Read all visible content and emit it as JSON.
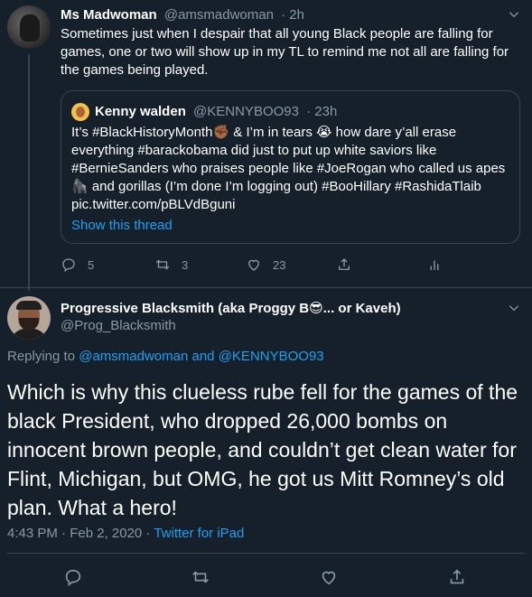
{
  "tweet1": {
    "name": "Ms Madwoman",
    "handle": "@amsmadwoman",
    "time": "· 2h",
    "text": "Sometimes just when I despair that all young Black people are falling for games, one or two will show up in my TL  to remind me not all are falling for the games being played.",
    "quote": {
      "name": "Kenny walden",
      "handle": "@KENNYBOO93",
      "time": "· 23h",
      "text": "It’s #BlackHistoryMonth✊🏾 & I’m in tears 😭 how dare y’all erase everything #barackobama did just to put up white saviors like #BernieSanders who praises people like #JoeRogan who called us apes 🦍 and gorillas (I’m done I’m logging out) #BooHillary #RashidaTlaib pic.twitter.com/pBLVdBguni",
      "show_thread": "Show this thread"
    },
    "actions": {
      "replies": "5",
      "retweets": "3",
      "likes": "23"
    }
  },
  "tweet2": {
    "name": "Progressive Blacksmith (aka Proggy B😎... or Kaveh)",
    "handle": "@Prog_Blacksmith",
    "replying_prefix": "Replying to",
    "reply_user1": "@amsmadwoman",
    "reply_and": "and",
    "reply_user2": "@KENNYBOO93",
    "text": "Which is why this clueless rube fell for the games of the black President, who dropped 26,000 bombs on innocent brown people, and couldn’t get clean water for Flint, Michigan, but OMG, he got us Mitt Romney’s old plan. What a hero!",
    "timestamp": "4:43 PM · Feb 2, 2020 ·",
    "source": "Twitter for iPad"
  },
  "colors": {
    "background": "#15202b",
    "muted": "#8899a6",
    "accent": "#1da1f2",
    "border": "#38444d"
  }
}
